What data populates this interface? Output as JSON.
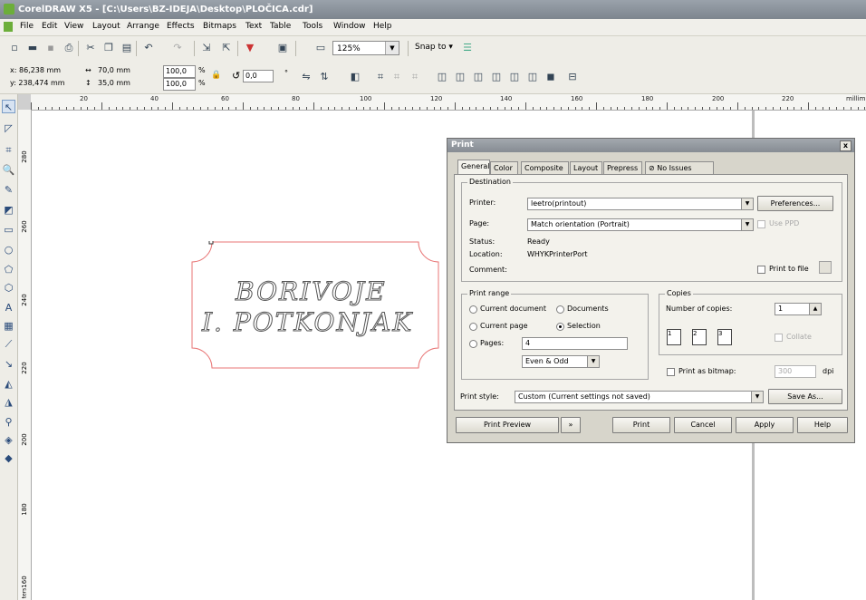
{
  "window": {
    "title": "CorelDRAW X5 - [C:\\Users\\BZ-IDEJA\\Desktop\\PLOČICA.cdr]"
  },
  "menu": [
    "File",
    "Edit",
    "View",
    "Layout",
    "Arrange",
    "Effects",
    "Bitmaps",
    "Text",
    "Table",
    "Tools",
    "Window",
    "Help"
  ],
  "toolbar": {
    "zoom": "125%",
    "snap_label": "Snap to"
  },
  "propertybar": {
    "x": "x: 86,238 mm",
    "y": "y: 238,474 mm",
    "width": "70,0 mm",
    "height": "35,0 mm",
    "scale_x": "100,0",
    "scale_y": "100,0",
    "percent": "%",
    "rotation": "0,0",
    "degree": "°"
  },
  "ruler": {
    "top": [
      "20",
      "40",
      "60",
      "80",
      "100",
      "120",
      "140",
      "160",
      "180",
      "200",
      "220",
      "millim"
    ],
    "left": [
      "280",
      "260",
      "240",
      "220",
      "200",
      "180",
      "160"
    ],
    "left_unit": "ters"
  },
  "plaque": {
    "line1": "BORIVOJE",
    "line2": "I. POTKONJAK"
  },
  "print_dialog": {
    "title": "Print",
    "close": "x",
    "tabs": [
      "General",
      "Color",
      "Composite",
      "Layout",
      "Prepress",
      "No Issues"
    ],
    "destination": {
      "label": "Destination",
      "printer_label": "Printer:",
      "printer_value": "leetro(printout)",
      "preferences": "Preferences...",
      "page_label": "Page:",
      "page_value": "Match orientation (Portrait)",
      "use_ppd": "Use PPD",
      "status_label": "Status:",
      "status_value": "Ready",
      "location_label": "Location:",
      "location_value": "WHYKPrinterPort",
      "comment_label": "Comment:",
      "print_to_file": "Print to file"
    },
    "print_range": {
      "label": "Print range",
      "current_document": "Current document",
      "documents": "Documents",
      "current_page": "Current page",
      "selection": "Selection",
      "pages": "Pages:",
      "pages_value": "4",
      "even_odd": "Even & Odd"
    },
    "copies": {
      "label": "Copies",
      "number_label": "Number of copies:",
      "number_value": "1",
      "collate": "Collate"
    },
    "print_as_bitmap": "Print as bitmap:",
    "dpi_value": "300",
    "dpi": "dpi",
    "print_style_label": "Print style:",
    "print_style_value": "Custom (Current settings not saved)",
    "save_as": "Save As...",
    "buttons": {
      "preview": "Print Preview",
      "print": "Print",
      "cancel": "Cancel",
      "apply": "Apply",
      "help": "Help"
    }
  },
  "colors": {
    "title_bar": "#8a929b",
    "plaque_outline": "#e87575",
    "canvas": "#ffffff"
  }
}
